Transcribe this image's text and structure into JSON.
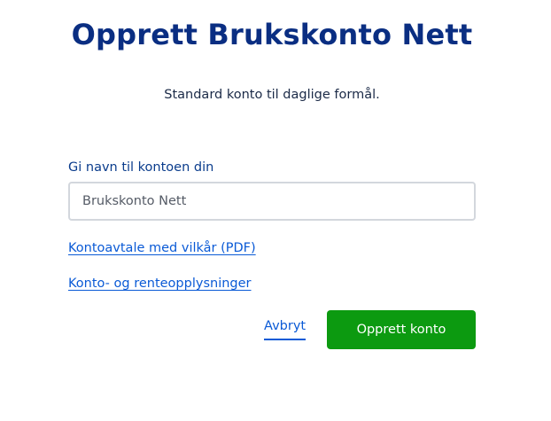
{
  "header": {
    "title": "Opprett Brukskonto Nett",
    "subtitle": "Standard konto til daglige formål."
  },
  "form": {
    "name_label": "Gi navn til kontoen din",
    "name_value": "Brukskonto Nett",
    "name_placeholder": ""
  },
  "links": {
    "terms": "Kontoavtale med vilkår (PDF)",
    "rates": "Konto- og renteopplysninger"
  },
  "actions": {
    "cancel_label": "Avbryt",
    "create_label": "Opprett konto"
  },
  "colors": {
    "title": "#0a2e82",
    "link": "#0a5ad6",
    "primary_button": "#0c9a10",
    "input_border": "#d3d7dd"
  }
}
